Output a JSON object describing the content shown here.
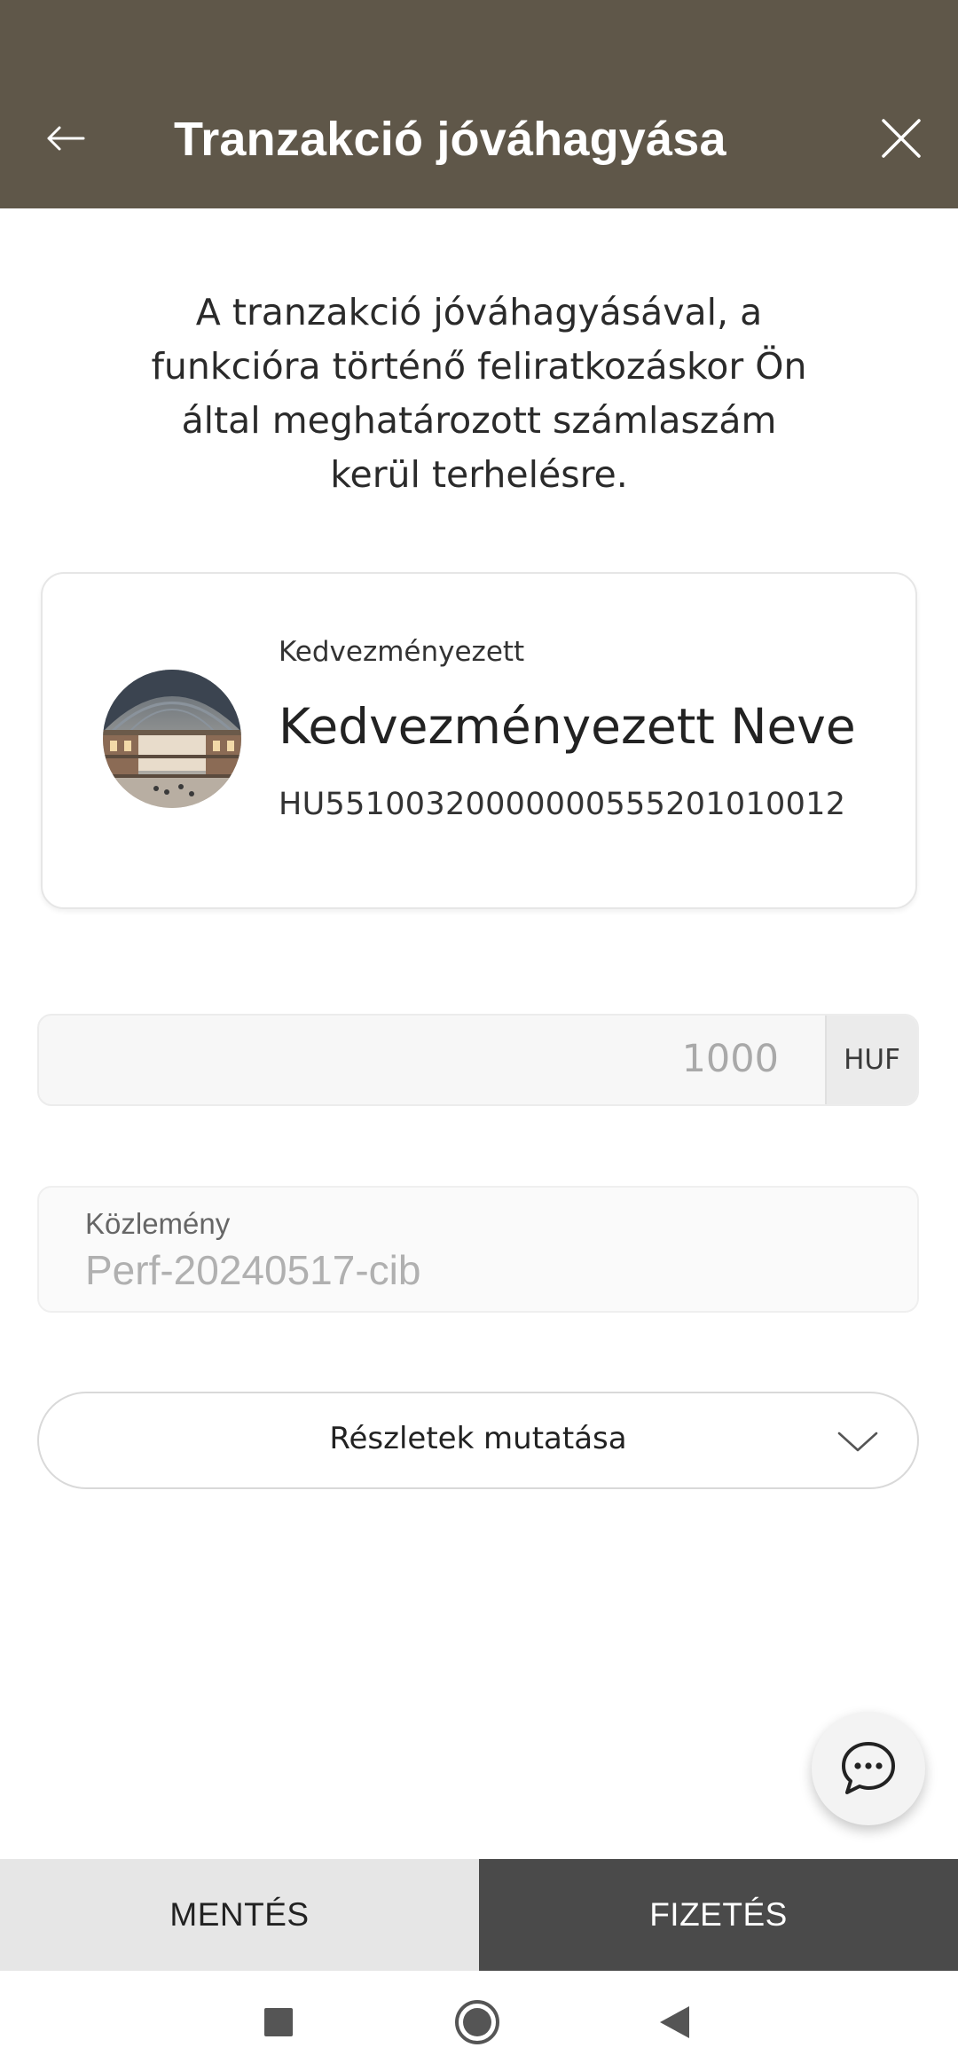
{
  "header": {
    "title": "Tranzakció jóváhagyása",
    "back_icon": "arrow-left-icon",
    "close_icon": "close-icon",
    "background_color": "#5f5749"
  },
  "intro": {
    "line1": "A tranzakció jóváhagyásával, a",
    "line2": "funkcióra történő feliratkozáskor Ön",
    "line3": "által meghatározott számlaszám",
    "line4": "kerül terhelésre."
  },
  "beneficiary": {
    "label": "Kedvezményezett",
    "name": "Kedvezményezett Neve",
    "iban": "HU55100320000000555201010012"
  },
  "amount": {
    "value": "1000",
    "currency": "HUF"
  },
  "note": {
    "label": "Közlemény",
    "value": "Perf-20240517-cib"
  },
  "details": {
    "label": "Részletek mutatása"
  },
  "chat": {
    "icon": "chat-bubble-icon"
  },
  "actions": {
    "save_label": "MENTÉS",
    "pay_label": "FIZETÉS",
    "pay_color": "#4a4a4a"
  },
  "system_nav": {
    "items": [
      "recents-square-icon",
      "home-circle-icon",
      "back-triangle-icon"
    ]
  }
}
